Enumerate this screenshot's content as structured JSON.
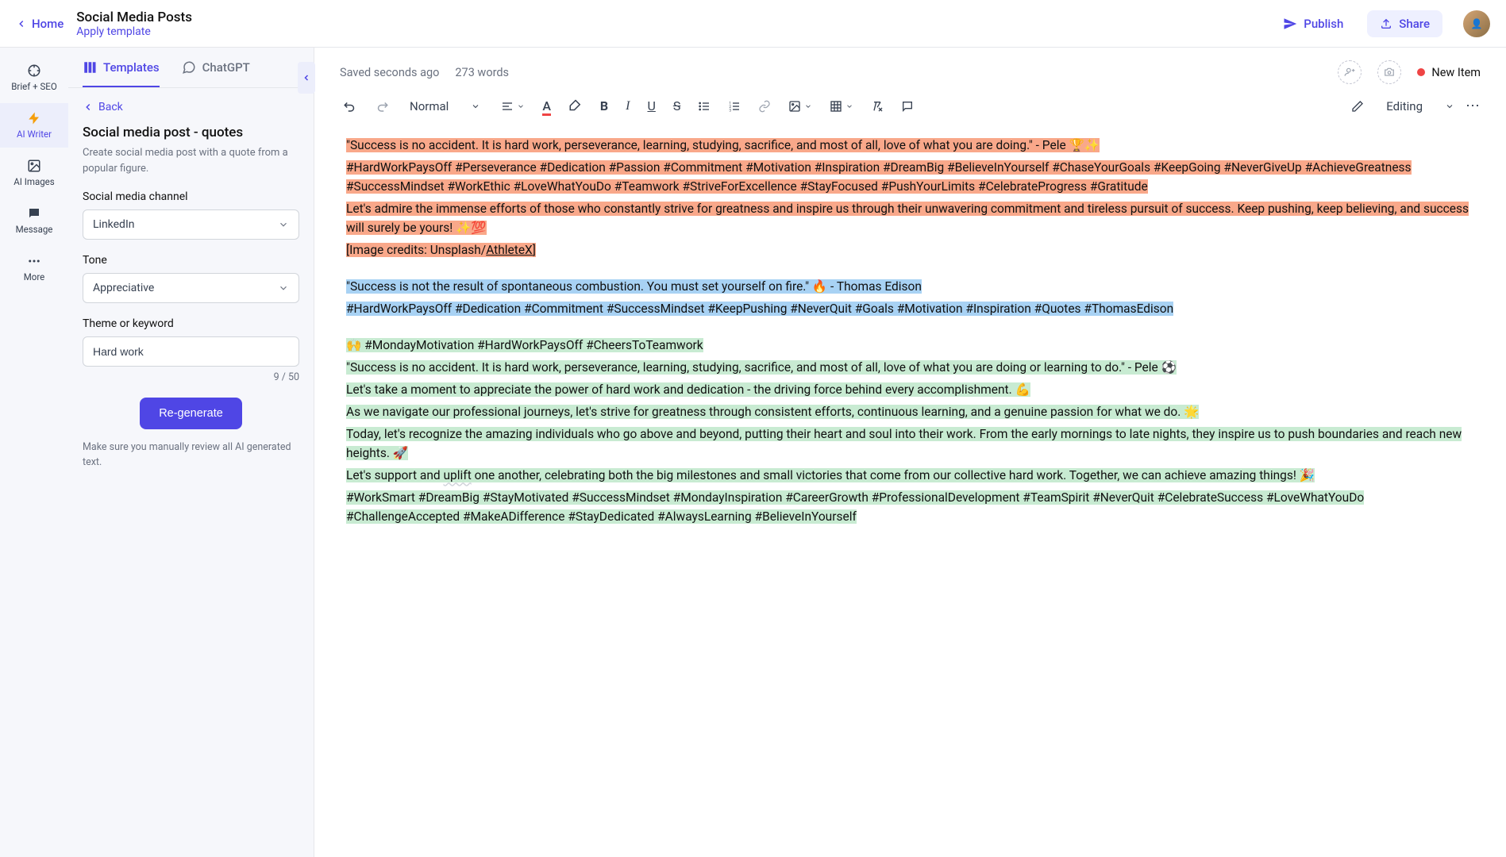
{
  "header": {
    "home": "Home",
    "title": "Social Media Posts",
    "apply_template": "Apply template",
    "publish": "Publish",
    "share": "Share"
  },
  "rail": {
    "items": [
      {
        "label": "Brief + SEO"
      },
      {
        "label": "AI Writer"
      },
      {
        "label": "AI Images"
      },
      {
        "label": "Message"
      },
      {
        "label": "More"
      }
    ]
  },
  "panel": {
    "tabs": {
      "templates": "Templates",
      "chatgpt": "ChatGPT"
    },
    "back": "Back",
    "template_title": "Social media post - quotes",
    "template_desc": "Create social media post with a quote from a popular figure.",
    "fields": {
      "channel_label": "Social media channel",
      "channel_value": "LinkedIn",
      "tone_label": "Tone",
      "tone_value": "Appreciative",
      "keyword_label": "Theme or keyword",
      "keyword_value": "Hard work",
      "char_count": "9 / 50"
    },
    "regenerate": "Re-generate",
    "disclaimer": "Make sure you manually review all AI generated text."
  },
  "editor": {
    "saved": "Saved seconds ago",
    "word_count": "273 words",
    "status": "New Item",
    "style_select": "Normal",
    "mode_select": "Editing"
  },
  "content": {
    "block1": {
      "p1": "\"Success is no accident. It is hard work, perseverance, learning, studying, sacrifice, and most of all, love of what you are doing.\" - Pele 🏆✨",
      "p2": "#HardWorkPaysOff #Perseverance #Dedication #Passion #Commitment #Motivation #Inspiration #DreamBig #BelieveInYourself #ChaseYourGoals #KeepGoing #NeverGiveUp #AchieveGreatness #SuccessMindset #WorkEthic #LoveWhatYouDo #Teamwork #StriveForExcellence #StayFocused #PushYourLimits #CelebrateProgress #Gratitude",
      "p3": "Let's admire the immense efforts of those who constantly strive for greatness and inspire us through their unwavering commitment and tireless pursuit of success. Keep pushing, keep believing, and success will surely be yours! ✨💯",
      "p4a": "[Image credits: Unsplash/",
      "p4b": "AthleteX",
      "p4c": "]"
    },
    "block2": {
      "p1": "\"Success is not the result of spontaneous combustion. You must set yourself on fire.\" 🔥 - Thomas Edison",
      "p2": "#HardWorkPaysOff #Dedication #Commitment #SuccessMindset #KeepPushing #NeverQuit #Goals #Motivation #Inspiration #Quotes #ThomasEdison"
    },
    "block3": {
      "p1": "🙌 #MondayMotivation #HardWorkPaysOff #CheersToTeamwork",
      "p2": "\"Success is no accident. It is hard work, perseverance, learning, studying, sacrifice, and most of all, love of what you are doing or learning to do.\" - Pele ⚽",
      "p3": "Let's take a moment to appreciate the power of hard work and dedication - the driving force behind every accomplishment. 💪",
      "p4": "As we navigate our professional journeys, let's strive for greatness through consistent efforts, continuous learning, and a genuine passion for what we do. 🌟",
      "p5a": "Today, let's recognize the amazing individuals who go above and beyond, putting their heart and soul into their work. From the early mornings to late nights, they inspire us to push boundaries and reach new heights. 🚀",
      "p6a": "Let's support and ",
      "p6b": "uplift",
      "p6c": " one another, celebrating both the big milestones and small victories that come from our collective hard work. Together, we can achieve amazing things! 🎉",
      "p7": "#WorkSmart #DreamBig #StayMotivated #SuccessMindset #MondayInspiration #CareerGrowth #ProfessionalDevelopment #TeamSpirit #NeverQuit #CelebrateSuccess #LoveWhatYouDo #ChallengeAccepted #MakeADifference #StayDedicated #AlwaysLearning #BelieveInYourself"
    }
  }
}
